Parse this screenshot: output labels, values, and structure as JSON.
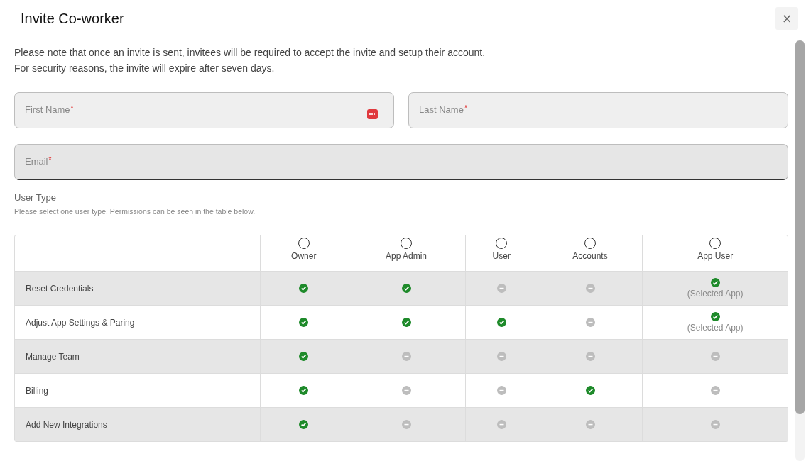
{
  "dialog": {
    "title": "Invite Co-worker",
    "close": "×"
  },
  "notes": [
    "Please note that once an invite is sent, invitees will be required to accept the invite and setup their account.",
    "For security reasons, the invite will expire after seven days."
  ],
  "fields": [
    {
      "placeholder": "First Name",
      "required_mark": "*",
      "kind": "half",
      "autofill_icon": true
    },
    {
      "placeholder": "Last Name",
      "required_mark": "*",
      "kind": "half",
      "autofill_icon": false
    },
    {
      "placeholder": "Email",
      "required_mark": "*",
      "kind": "full",
      "autofill_icon": false
    }
  ],
  "user_type": {
    "label": "User Type",
    "hint": "Please select one user type. Permissions can be seen in the table below."
  },
  "table": {
    "columns": [
      {
        "label": "Owner",
        "selected": false
      },
      {
        "label": "App Admin",
        "selected": false
      },
      {
        "label": "User",
        "selected": false
      },
      {
        "label": "Accounts",
        "selected": false
      },
      {
        "label": "App User",
        "selected": false
      }
    ],
    "rows": [
      {
        "label": "Reset Credentials",
        "cells": [
          {
            "allowed": true
          },
          {
            "allowed": true
          },
          {
            "allowed": false
          },
          {
            "allowed": false
          },
          {
            "allowed": true,
            "note": "(Selected App)"
          }
        ]
      },
      {
        "label": "Adjust App Settings & Paring",
        "cells": [
          {
            "allowed": true
          },
          {
            "allowed": true
          },
          {
            "allowed": true
          },
          {
            "allowed": false
          },
          {
            "allowed": true,
            "note": "(Selected App)"
          }
        ]
      },
      {
        "label": "Manage Team",
        "cells": [
          {
            "allowed": true
          },
          {
            "allowed": false
          },
          {
            "allowed": false
          },
          {
            "allowed": false
          },
          {
            "allowed": false
          }
        ]
      },
      {
        "label": "Billing",
        "cells": [
          {
            "allowed": true
          },
          {
            "allowed": false
          },
          {
            "allowed": false
          },
          {
            "allowed": true
          },
          {
            "allowed": false
          }
        ]
      },
      {
        "label": "Add New Integrations",
        "cells": [
          {
            "allowed": true
          },
          {
            "allowed": false
          },
          {
            "allowed": false
          },
          {
            "allowed": false
          },
          {
            "allowed": false
          }
        ]
      }
    ]
  }
}
